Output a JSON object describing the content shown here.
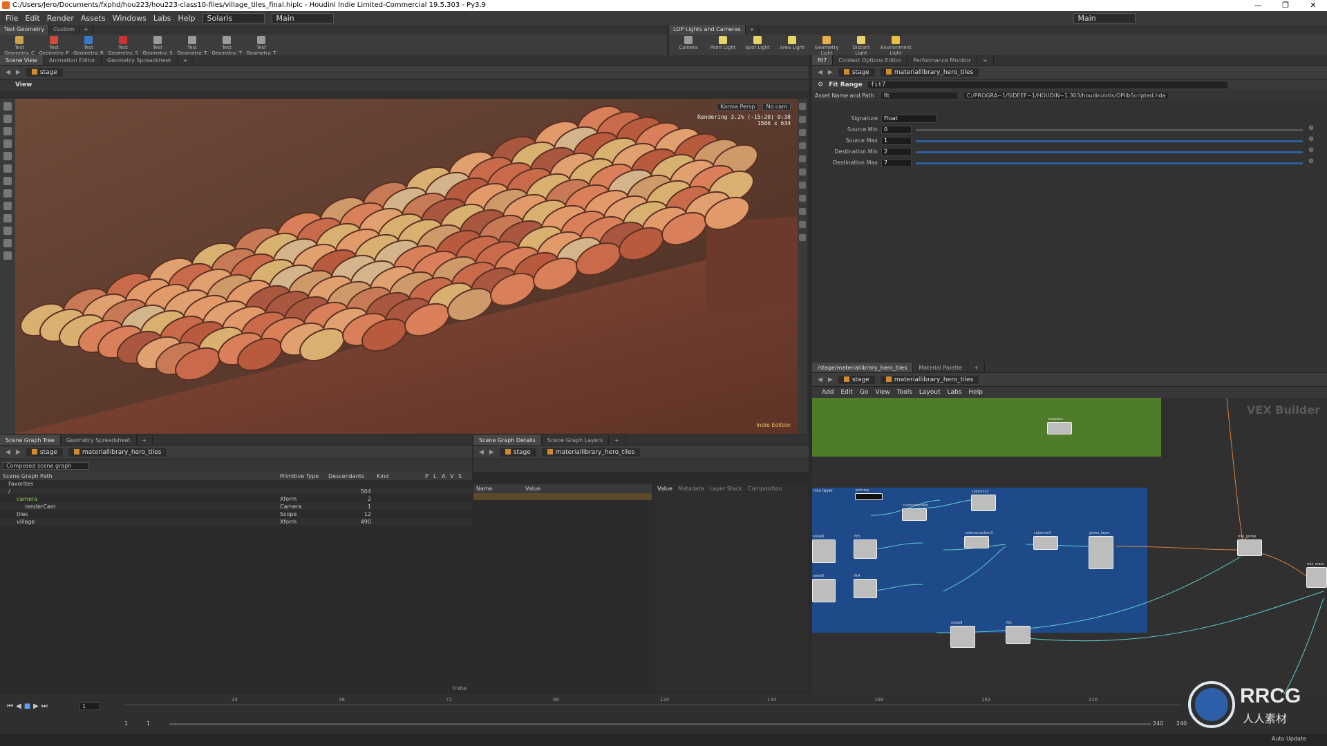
{
  "window": {
    "title": "C:/Users/Jero/Documents/fxphd/hou223/hou223-class10-files/village_tiles_final.hiplc - Houdini Indie Limited-Commercial 19.5.303 - Py3.9",
    "minimize": "—",
    "maximize": "❐",
    "close": "✕"
  },
  "menu": {
    "items": [
      "File",
      "Edit",
      "Render",
      "Assets",
      "Windows",
      "Labs",
      "Help"
    ],
    "desktop": "Solaris",
    "context": "Main",
    "right_context": "Main"
  },
  "shelf_left": {
    "tabs": [
      "Test Geometry",
      "Custom"
    ],
    "tools": [
      {
        "label": "Test Geometry: C",
        "color": "#c9a24a"
      },
      {
        "label": "Test Geometry: P",
        "color": "#cc4b3a"
      },
      {
        "label": "Test Geometry: R",
        "color": "#3a79c9"
      },
      {
        "label": "Test Geometry: S",
        "color": "#d03030"
      },
      {
        "label": "Test Geometry: S",
        "color": "#9a9a9a"
      },
      {
        "label": "Test Geometry: T",
        "color": "#9a9a9a"
      },
      {
        "label": "Test Geometry: T",
        "color": "#9a9a9a"
      },
      {
        "label": "Test Geometry: T",
        "color": "#9a9a9a"
      }
    ]
  },
  "shelf_right": {
    "tabs": [
      "LOP Lights and Cameras"
    ],
    "tools": [
      {
        "label": "Camera",
        "color": "#9a9a9a"
      },
      {
        "label": "Point Light",
        "color": "#e8d36a"
      },
      {
        "label": "Spot Light",
        "color": "#e8d36a"
      },
      {
        "label": "Area Light",
        "color": "#e8d36a"
      },
      {
        "label": "Geometry Light",
        "color": "#e8b04a"
      },
      {
        "label": "Distant Light",
        "color": "#e8d36a"
      },
      {
        "label": "Environment Light",
        "color": "#e8c04a"
      }
    ]
  },
  "viewer": {
    "tabs": [
      "Scene View",
      "Animation Editor",
      "Geometry Spreadsheet"
    ],
    "path": "stage",
    "view_label": "View",
    "renderer": "Karma Persp",
    "camera": "No cam",
    "status_line1": "Rendering  3.2%  (-15:20)  0:38",
    "status_line2": "1506 x 634",
    "watermark": "Indie Edition"
  },
  "parms": {
    "tabs": [
      "fit7",
      "Context Options Editor",
      "Performance Monitor"
    ],
    "path_root": "stage",
    "path_node": "materiallibrary_hero_tiles",
    "node_type": "Fit Range",
    "node_name": "fit7",
    "asset_label": "Asset Name and Path",
    "asset_name": "fit",
    "asset_path": "C:/PROGRA~1/SIDEEF~1/HOUDIN~1.303/houdini/otls/OPlibScripted.hda",
    "rows": [
      {
        "label": "Signature",
        "value": "Float"
      },
      {
        "label": "Source Min",
        "value": "0",
        "fill": 0.0
      },
      {
        "label": "Source Max",
        "value": "1",
        "fill": 1.0
      },
      {
        "label": "Destination Min",
        "value": "2",
        "fill": 1.0
      },
      {
        "label": "Destination Max",
        "value": "7",
        "fill": 1.0
      }
    ]
  },
  "scene_tree": {
    "tabs": [
      "Scene Graph Tree",
      "Geometry Spreadsheet"
    ],
    "path_root": "stage",
    "path_node": "materiallibrary_hero_tiles",
    "filter": "Composed scene graph",
    "columns": [
      "Scene Graph Path",
      "Primitive Type",
      "Descendants",
      "Kind",
      "P",
      "L",
      "A",
      "V",
      "S"
    ],
    "rows": [
      {
        "name": "Favorites",
        "type": "",
        "desc": "",
        "indent": 1
      },
      {
        "name": "/",
        "type": "",
        "desc": "504",
        "indent": 1
      },
      {
        "name": "camera",
        "type": "Xform",
        "desc": "2",
        "indent": 2
      },
      {
        "name": "renderCam",
        "type": "Camera",
        "desc": "1",
        "indent": 3
      },
      {
        "name": "tiles",
        "type": "Scope",
        "desc": "12",
        "indent": 2
      },
      {
        "name": "village",
        "type": "Xform",
        "desc": "490",
        "indent": 2
      }
    ],
    "footer": "Indie"
  },
  "details": {
    "tabs": [
      "Scene Graph Details",
      "Scene Graph Layers"
    ],
    "path_root": "stage",
    "path_node": "materiallibrary_hero_tiles",
    "columns": [
      "Name",
      "Value"
    ],
    "sub_tabs": [
      "Value",
      "Metadata",
      "Layer Stack",
      "Composition"
    ]
  },
  "network": {
    "tabs": [
      "/stage/materiallibrary_hero_tiles",
      "Material Palette"
    ],
    "path_root": "stage",
    "path_node": "materiallibrary_hero_tiles",
    "menu": [
      "Add",
      "Edit",
      "Go",
      "View",
      "Tools",
      "Layout",
      "Labs",
      "Help"
    ],
    "context_label": "VEX Builder",
    "box_label": "mix layer",
    "nodes": [
      "primary",
      "colorcorrection",
      "colormix2",
      "noise6",
      "fit3",
      "colorcorrection3",
      "colormix3",
      "grime_layer",
      "noise5",
      "fit4",
      "mix_grime",
      "mix_mass",
      "compare",
      "noise8",
      "fit1"
    ]
  },
  "timeline": {
    "frame": "1",
    "ticks": [
      "24",
      "48",
      "72",
      "96",
      "120",
      "144",
      "168",
      "192",
      "216"
    ],
    "start": "1",
    "start2": "1",
    "end": "240",
    "end2": "240",
    "auto_update": "Auto Update"
  },
  "logo": {
    "text": "RRCG",
    "subtext": "人人素材"
  }
}
